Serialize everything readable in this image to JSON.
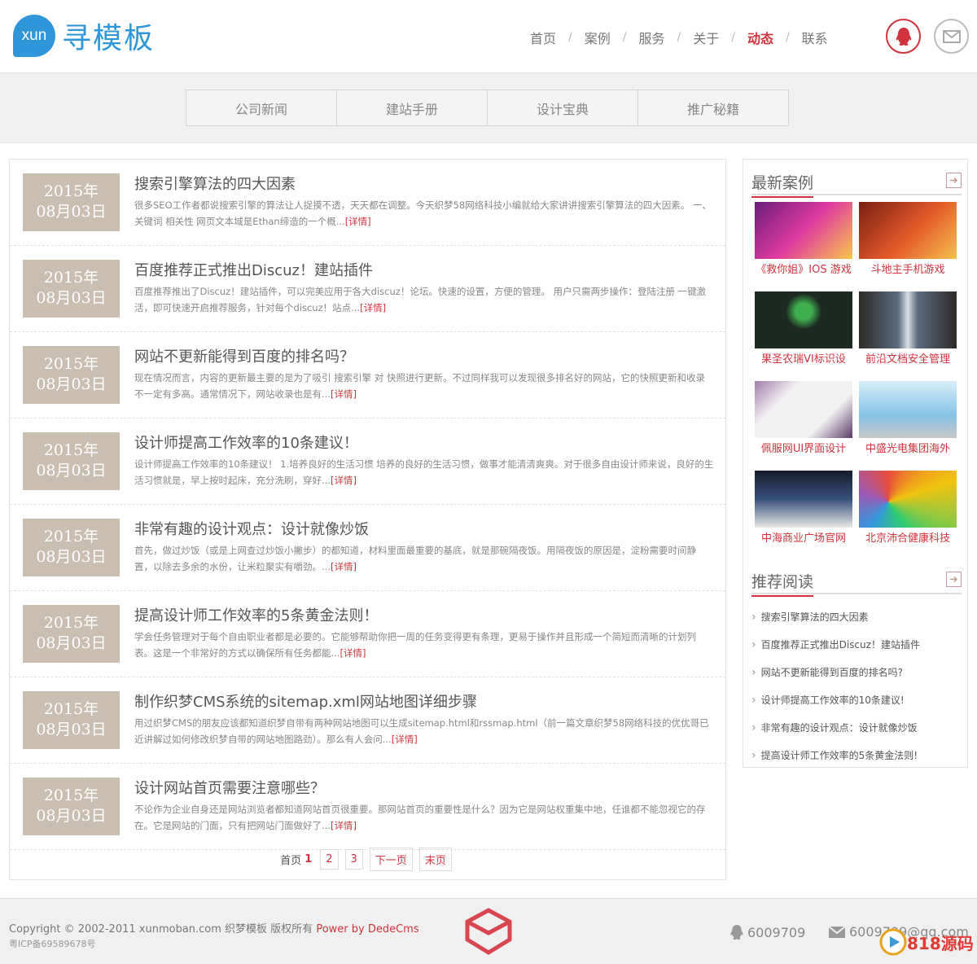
{
  "brand": {
    "badge": "xun",
    "name": "寻模板"
  },
  "nav": {
    "items": [
      {
        "label": "首页",
        "active": false
      },
      {
        "label": "案例",
        "active": false
      },
      {
        "label": "服务",
        "active": false
      },
      {
        "label": "关于",
        "active": false
      },
      {
        "label": "动态",
        "active": true
      },
      {
        "label": "联系",
        "active": false
      }
    ],
    "separator": "/"
  },
  "subnav": [
    "公司新闻",
    "建站手册",
    "设计宝典",
    "推广秘籍"
  ],
  "articles": [
    {
      "year": "2015年",
      "day": "08月03日",
      "title": "搜索引擎算法的四大因素",
      "desc": "很多SEO工作者都说搜索引擎的算法让人捉摸不透，天天都在调整。今天织梦58网络科技小编就给大家讲讲搜索引擎算法的四大因素。 一、 关键词 相关性 网页文本域是Ethan缔造的一个概...",
      "more": "[详情]"
    },
    {
      "year": "2015年",
      "day": "08月03日",
      "title": "百度推荐正式推出Discuz！建站插件",
      "desc": "百度推荐推出了Discuz！建站插件，可以完美应用于各大discuz！论坛。快速的设置，方便的管理。 用户只需两步操作：登陆注册 一键激活，即可快速开启推荐服务，针对每个discuz！站点...",
      "more": "[详情]"
    },
    {
      "year": "2015年",
      "day": "08月03日",
      "title": "网站不更新能得到百度的排名吗？",
      "desc": "现在情况而言，内容的更新最主要的是为了吸引 搜索引擎 对 快照进行更新。不过同样我可以发现很多排名好的网站，它的快照更新和收录不一定有多高。通常情况下，网站收录也是有...",
      "more": "[详情]"
    },
    {
      "year": "2015年",
      "day": "08月03日",
      "title": "设计师提高工作效率的10条建议！",
      "desc": "设计师提高工作效率的10条建议！ 1.培养良好的生活习惯 培养的良好的生活习惯，做事才能清清爽爽。对于很多自由设计师来说，良好的生活习惯就是，早上按时起床，充分洗刷，穿好...",
      "more": "[详情]"
    },
    {
      "year": "2015年",
      "day": "08月03日",
      "title": "非常有趣的设计观点：设计就像炒饭",
      "desc": "首先，做过炒饭（或是上网查过炒饭小撇步）的都知道，材料里面最重要的基底，就是那碗隔夜饭。用隔夜饭的原因是，淀粉需要时间静置，以除去多余的水份，让米粒聚实有嚼劲。...",
      "more": "[详情]"
    },
    {
      "year": "2015年",
      "day": "08月03日",
      "title": "提高设计师工作效率的5条黄金法则！",
      "desc": "学会任务管理对于每个自由职业者都是必要的。它能够帮助你把一周的任务变得更有条理，更易于操作并且形成一个简短而清晰的计划列表。这是一个非常好的方式以确保所有任务都能...",
      "more": "[详情]"
    },
    {
      "year": "2015年",
      "day": "08月03日",
      "title": "制作织梦CMS系统的sitemap.xml网站地图详细步骤",
      "desc": "用过织梦CMS的朋友应该都知道织梦自带有两种网站地图可以生成sitemap.html和rssmap.html（前一篇文章织梦58网络科技的优优哥已近讲解过如何修改织梦自带的网站地图路劲）。那么有人会问...",
      "more": "[详情]"
    },
    {
      "year": "2015年",
      "day": "08月03日",
      "title": "设计网站首页需要注意哪些？",
      "desc": "不论作为企业自身还是网站浏览者都知道网站首页很重要。那网站首页的重要性是什么？因为它是网站权重集中地，任谁都不能忽视它的存在。它是网站的门面，只有把网站门面做好了...",
      "more": "[详情]"
    }
  ],
  "pager": {
    "first": "首页",
    "current": "1",
    "pages": [
      "2",
      "3"
    ],
    "next": "下一页",
    "last": "末页"
  },
  "sidebar": {
    "cases_title": "最新案例",
    "cases": [
      {
        "label": "《救你姐》IOS 游戏",
        "thumb": "cartoon-girl-game-thumb",
        "color": "#b02a8e"
      },
      {
        "label": "斗地主手机游戏",
        "thumb": "card-game-thumb",
        "color": "#c0392b"
      },
      {
        "label": "果圣农瑞VI标识设",
        "thumb": "green-lotus-logo-thumb",
        "color": "#1d2a22"
      },
      {
        "label": "前沿文档安全管理",
        "thumb": "tablet-app-thumb",
        "color": "#3a4b5c"
      },
      {
        "label": "佩服网UI界面设计",
        "thumb": "ecommerce-site-thumb",
        "color": "#8d6a9a"
      },
      {
        "label": "中盛光电集团海外",
        "thumb": "laptop-site-thumb",
        "color": "#5d8fb5"
      },
      {
        "label": "中海商业广场官网",
        "thumb": "city-night-site-thumb",
        "color": "#23324a"
      },
      {
        "label": "北京沛合健康科技",
        "thumb": "color-wheel-site-thumb",
        "color": "#2d6e4e"
      }
    ],
    "reco_title": "推荐阅读",
    "reco": [
      "搜索引擎算法的四大因素",
      "百度推荐正式推出Discuz！建站插件",
      "网站不更新能得到百度的排名吗?",
      "设计师提高工作效率的10条建议!",
      "非常有趣的设计观点：设计就像炒饭",
      "提高设计师工作效率的5条黄金法则!"
    ]
  },
  "footer": {
    "copyright": "Copyright © 2002-2011 xunmoban.com 织梦模板 版权所有",
    "powered": "Power by DedeCms",
    "icp": "粤ICP备69589678号",
    "qq": "6009709",
    "email": "6009709@qq.com"
  },
  "watermark": {
    "text": "818源码"
  },
  "colors": {
    "accent": "#d0333d",
    "brand": "#2f97d9",
    "date_bg": "#c9beb0"
  }
}
